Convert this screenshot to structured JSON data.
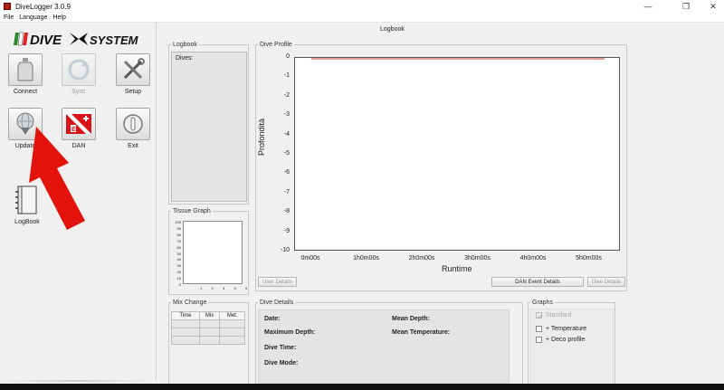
{
  "window": {
    "title": "DiveLogger 3.0.9",
    "controls": {
      "minimize": "—",
      "restore": "❐",
      "close": "✕"
    }
  },
  "menu": [
    "File",
    "Language",
    "Help"
  ],
  "logo": {
    "text": "DIVE SYSTEM",
    "icon": "dive-system-logo"
  },
  "tools": {
    "connect": {
      "label": "Connect",
      "icon": "tank-icon"
    },
    "sync": {
      "label": "Sync",
      "icon": "sync-icon",
      "disabled": true
    },
    "setup": {
      "label": "Setup",
      "icon": "tools-icon"
    },
    "update": {
      "label": "Update",
      "icon": "globe-download-icon"
    },
    "dan": {
      "label": "DAN",
      "icon": "dan-flag-icon"
    },
    "exit": {
      "label": "Exit",
      "icon": "power-icon"
    },
    "logbook": {
      "label": "LogBook",
      "icon": "notebook-icon"
    }
  },
  "annotation": {
    "arrow_color": "#e3120b"
  },
  "main": {
    "view_title": "Logbook",
    "logbook": {
      "legend": "Logbook",
      "dives_label": "Dives:"
    },
    "tissue_graph": {
      "legend": "Tissue Graph",
      "y_ticks": [
        "100",
        "90",
        "80",
        "70",
        "60",
        "50",
        "40",
        "30",
        "20",
        "10",
        "0"
      ],
      "x_ticks": [
        "1",
        "2",
        "3",
        "4",
        "5"
      ]
    },
    "dive_profile": {
      "legend": "Dive Profile",
      "ylabel": "Profondità",
      "xlabel": "Runtime",
      "y_ticks": [
        "0",
        "-1",
        "-2",
        "-3",
        "-4",
        "-5",
        "-6",
        "-7",
        "-8",
        "-9",
        "-10"
      ],
      "x_ticks": [
        "0m00s",
        "1h0m00s",
        "2h0m00s",
        "3h0m00s",
        "4h0m00s",
        "5h0m00s"
      ],
      "line_color": "#c0392b"
    },
    "buttons": {
      "user_details": "User Details",
      "dan_event_details": "DAN Event Details",
      "dive_details": "Dive Details"
    },
    "mix_change": {
      "legend": "Mix Change",
      "columns": [
        "Time",
        "Mix",
        "Met."
      ]
    },
    "dive_details": {
      "legend": "Dive Details",
      "date": "Date:",
      "max_depth": "Maximum Depth:",
      "dive_time": "Dive Time:",
      "dive_mode": "Dive Mode:",
      "mean_depth": "Mean Depth:",
      "mean_temp": "Mean Temperature:"
    },
    "graphs": {
      "legend": "Graphs",
      "standard": "Standard",
      "temperature": "+ Temperature",
      "deco": "+ Deco profile"
    }
  },
  "chart_data": {
    "type": "line",
    "title": "",
    "xlabel": "Runtime",
    "ylabel": "Profondità",
    "x_ticks": [
      "0m00s",
      "1h0m00s",
      "2h0m00s",
      "3h0m00s",
      "4h0m00s",
      "5h0m00s"
    ],
    "ylim": [
      -10,
      0
    ],
    "series": [
      {
        "values": [
          0,
          0
        ]
      }
    ],
    "grid": false
  }
}
